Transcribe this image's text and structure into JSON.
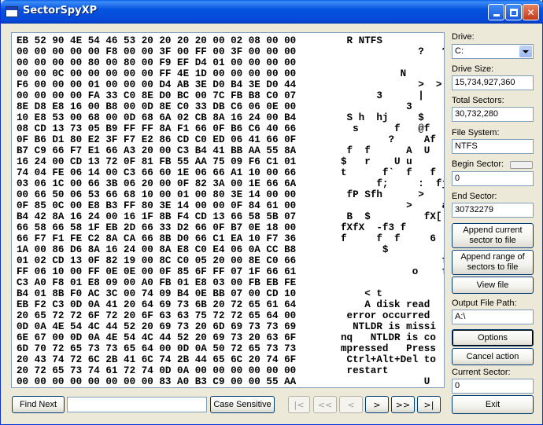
{
  "window": {
    "title": "SectorSpyXP"
  },
  "hex_lines": [
    "EB 52 90 4E 54 46 53 20 20 20 20 00 02 08 00 00",
    "00 00 00 00 00 F8 00 00 3F 00 FF 00 3F 00 00 00",
    "00 00 00 00 80 00 80 00 F9 EF D4 01 00 00 00 00",
    "00 00 0C 00 00 00 00 00 FF 4E 1D 00 00 00 00 00",
    "F6 00 00 00 01 00 00 00 D4 AB 3E D0 B4 3E D0 44",
    "00 00 00 00 FA 33 C0 8E D0 BC 00 7C FB B8 C0 07",
    "8E D8 E8 16 00 B8 00 0D 8E C0 33 DB C6 06 0E 00",
    "10 E8 53 00 68 00 0D 68 6A 02 CB 8A 16 24 00 B4",
    "08 CD 13 73 05 B9 FF FF 8A F1 66 0F B6 C6 40 66",
    "0F B6 D1 80 E2 3F F7 E2 86 CD C0 ED 06 41 66 0F",
    "B7 C9 66 F7 E1 66 A3 20 00 C3 B4 41 BB AA 55 8A",
    "16 24 00 CD 13 72 0F 81 FB 55 AA 75 09 F6 C1 01",
    "74 04 FE 06 14 00 C3 66 60 1E 06 66 A1 10 00 66",
    "03 06 1C 00 66 3B 06 20 00 0F 82 3A 00 1E 66 6A",
    "00 66 50 06 53 66 68 10 00 01 00 80 3E 14 00 00",
    "0F 85 0C 00 E8 B3 FF 80 3E 14 00 00 0F 84 61 00",
    "B4 42 8A 16 24 00 16 1F 8B F4 CD 13 66 58 5B 07",
    "66 58 66 58 1F EB 2D 66 33 D2 66 0F B7 0E 18 00",
    "66 F7 F1 FE C2 8A CA 66 8B D0 66 C1 EA 10 F7 36",
    "1A 00 86 D6 8A 16 24 00 8A E8 C0 E4 06 0A CC B8",
    "01 02 CD 13 0F 82 19 00 8C C0 05 20 00 8E C0 66",
    "FF 06 10 00 FF 0E 0E 00 0F 85 6F FF 07 1F 66 61",
    "C3 A0 F8 01 E8 09 00 A0 FB 01 E8 03 00 FB EB FE",
    "B4 01 8B F0 AC 3C 00 74 09 B4 0E BB 07 00 CD 10",
    "EB F2 C3 0D 0A 41 20 64 69 73 6B 20 72 65 61 64",
    "20 65 72 72 6F 72 20 6F 63 63 75 72 72 65 64 00",
    "0D 0A 4E 54 4C 44 52 20 69 73 20 6D 69 73 73 69",
    "6E 67 00 0D 0A 4E 54 4C 44 52 20 69 73 20 63 6F",
    "6D 70 72 65 73 73 65 64 00 0D 0A 50 72 65 73 73",
    "20 43 74 72 6C 2B 41 6C 74 2B 44 65 6C 20 74 6F",
    "20 72 65 73 74 61 72 74 0D 0A 00 00 00 00 00 00",
    "00 00 00 00 00 00 00 00 83 A0 B3 C9 00 00 55 AA"
  ],
  "ascii_lines": [
    " R NTFS",
    "             ?   ?",
    "",
    "          N",
    "             >  > D",
    "      3      |",
    "           3",
    " S h  hj     $",
    "  s      f   @f",
    "        ?     Af",
    " f  f      A  U",
    "$   r    U u",
    "t      f`  f   f",
    "      f;     :  fj",
    " fP Sfh      >",
    "           >     a",
    " B  $         fX[",
    "fXfX  -f3 f",
    "f     f  f     6",
    "       $",
    "                 f",
    "            o    fa",
    "",
    "    < t",
    "    A disk read",
    " error occurred",
    "  NTLDR is missi",
    "nq   NTLDR is co",
    "mpressed   Press",
    " Ctrl+Alt+Del to",
    " restart",
    "              U"
  ],
  "right_panel": {
    "drive_label": "Drive:",
    "drive_value": "C:",
    "drive_size_label": "Drive Size:",
    "drive_size_value": "15,734,927,360",
    "total_sectors_label": "Total Sectors:",
    "total_sectors_value": "30,732,280",
    "file_system_label": "File System:",
    "file_system_value": "NTFS",
    "begin_sector_label": "Begin Sector:",
    "begin_sector_value": "0",
    "end_sector_label": "End Sector:",
    "end_sector_value": "30732279",
    "append_current_label": "Append current sector to file",
    "append_range_label": "Append range of sectors to file",
    "view_file_label": "View file",
    "output_path_label": "Output File Path:",
    "output_path_value": "A:\\",
    "options_label": "Options",
    "cancel_action_label": "Cancel action",
    "current_sector_label": "Current Sector:",
    "current_sector_value": "0",
    "exit_label": "Exit"
  },
  "bottom_bar": {
    "find_next_label": "Find Next",
    "find_value": "",
    "case_sensitive_label": "Case Sensitive",
    "nav_first": "|<",
    "nav_fast_back": "<<",
    "nav_back": "<",
    "nav_forward": ">",
    "nav_fast_forward": ">>",
    "nav_last": ">|"
  }
}
